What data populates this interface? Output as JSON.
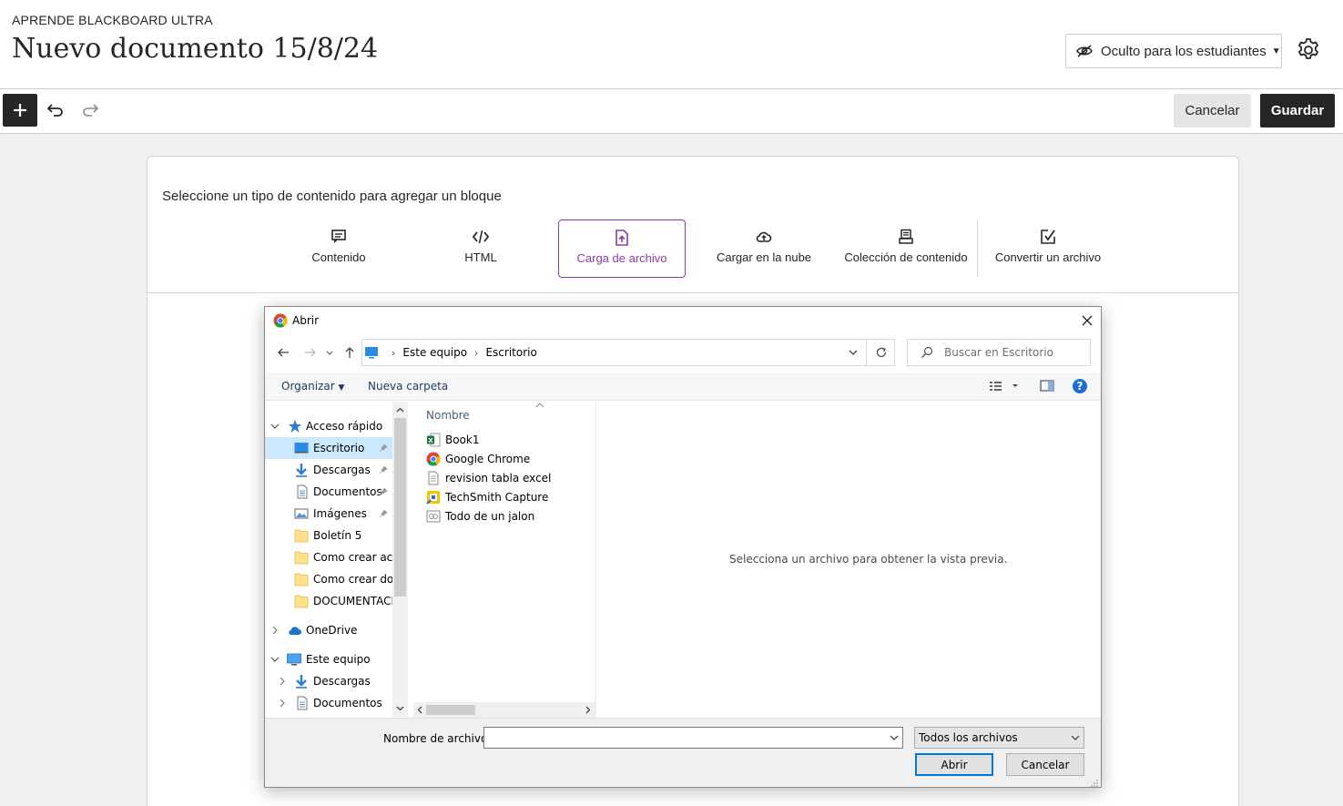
{
  "header": {
    "course": "APRENDE BLACKBOARD ULTRA",
    "title": "Nuevo documento 15/8/24",
    "visibility": "Oculto para los estudiantes"
  },
  "toolbar": {
    "cancel_label": "Cancelar",
    "save_label": "Guardar"
  },
  "panel": {
    "prompt": "Seleccione un tipo de contenido para agregar un bloque",
    "block_types": [
      {
        "label": "Contenido",
        "icon": "text-block-icon"
      },
      {
        "label": "HTML",
        "icon": "code-icon"
      },
      {
        "label": "Carga de archivo",
        "icon": "file-upload-icon",
        "active": true
      },
      {
        "label": "Cargar en la nube",
        "icon": "cloud-upload-icon"
      },
      {
        "label": "Colección de contenido",
        "icon": "content-collection-icon"
      },
      {
        "label": "Convertir un archivo",
        "icon": "convert-file-icon"
      }
    ],
    "accent_color": "#8c3ba7"
  },
  "dialog": {
    "title": "Abrir",
    "address": [
      "Este equipo",
      "Escritorio"
    ],
    "search_placeholder": "Buscar en Escritorio",
    "organize": "Organizar",
    "new_folder": "Nueva carpeta",
    "tree": [
      {
        "label": "Acceso rápido",
        "icon": "star-icon",
        "expanded": true
      },
      {
        "label": "Escritorio",
        "icon": "desktop-icon",
        "selected": true,
        "pinned": true
      },
      {
        "label": "Descargas",
        "icon": "download-icon",
        "pinned": true
      },
      {
        "label": "Documentos",
        "icon": "documents-icon",
        "pinned": true
      },
      {
        "label": "Imágenes",
        "icon": "pictures-icon",
        "pinned": true
      },
      {
        "label": "Boletín 5",
        "icon": "folder-icon"
      },
      {
        "label": "Como crear acti",
        "icon": "folder-icon"
      },
      {
        "label": "Como crear doc",
        "icon": "folder-icon"
      },
      {
        "label": "DOCUMENTACIO",
        "icon": "folder-icon"
      },
      {
        "label": "OneDrive",
        "icon": "cloud-icon",
        "expanded": false
      },
      {
        "label": "Este equipo",
        "icon": "computer-icon",
        "expanded": true
      },
      {
        "label": "Descargas",
        "icon": "download-icon",
        "expanded": false
      },
      {
        "label": "Documentos",
        "icon": "documents-icon",
        "expanded": false
      }
    ],
    "column_header": "Nombre",
    "files": [
      {
        "name": "Book1",
        "icon": "excel-icon"
      },
      {
        "name": "Google Chrome",
        "icon": "chrome-icon"
      },
      {
        "name": "revision tabla excel",
        "icon": "text-file-icon"
      },
      {
        "name": "TechSmith Capture",
        "icon": "techsmith-icon"
      },
      {
        "name": "Todo de un jalon",
        "icon": "shortcut-icon"
      }
    ],
    "preview_text": "Selecciona un archivo para obtener la vista previa.",
    "filename_label": "Nombre de archivo:",
    "filename_value": "",
    "filetype": "Todos los archivos",
    "open_label": "Abrir",
    "cancel_label": "Cancelar"
  }
}
